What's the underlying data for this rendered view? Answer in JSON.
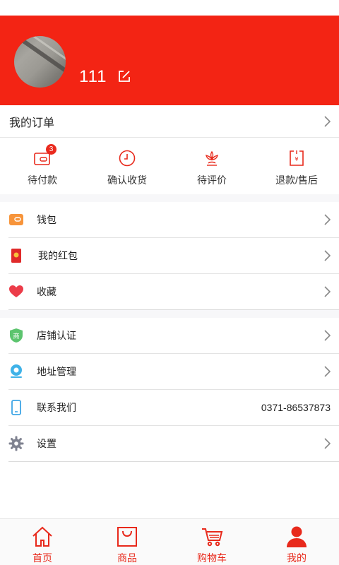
{
  "header": {
    "username": "111"
  },
  "orders": {
    "title": "我的订单",
    "items": [
      {
        "label": "待付款",
        "badge": "3",
        "icon": "wallet-icon"
      },
      {
        "label": "确认收货",
        "icon": "clock-icon"
      },
      {
        "label": "待评价",
        "icon": "flower-icon"
      },
      {
        "label": "退款/售后",
        "icon": "refund-icon"
      }
    ]
  },
  "menu_group1": [
    {
      "label": "钱包",
      "icon": "wallet-orange-icon"
    },
    {
      "label": "我的红包",
      "icon": "red-envelope-icon"
    },
    {
      "label": "收藏",
      "icon": "heart-icon"
    }
  ],
  "menu_group2": [
    {
      "label": "店铺认证",
      "icon": "shield-shop-icon"
    },
    {
      "label": "地址管理",
      "icon": "location-pin-icon"
    },
    {
      "label": "联系我们",
      "icon": "phone-icon",
      "value": "0371-86537873"
    },
    {
      "label": "设置",
      "icon": "gear-icon"
    }
  ],
  "tabbar": {
    "items": [
      {
        "label": "首页",
        "icon": "home-icon"
      },
      {
        "label": "商品",
        "icon": "bag-icon"
      },
      {
        "label": "购物车",
        "icon": "cart-icon"
      },
      {
        "label": "我的",
        "icon": "user-icon"
      }
    ]
  },
  "colors": {
    "brand_red": "#f32414",
    "tab_red": "#e8291b"
  }
}
